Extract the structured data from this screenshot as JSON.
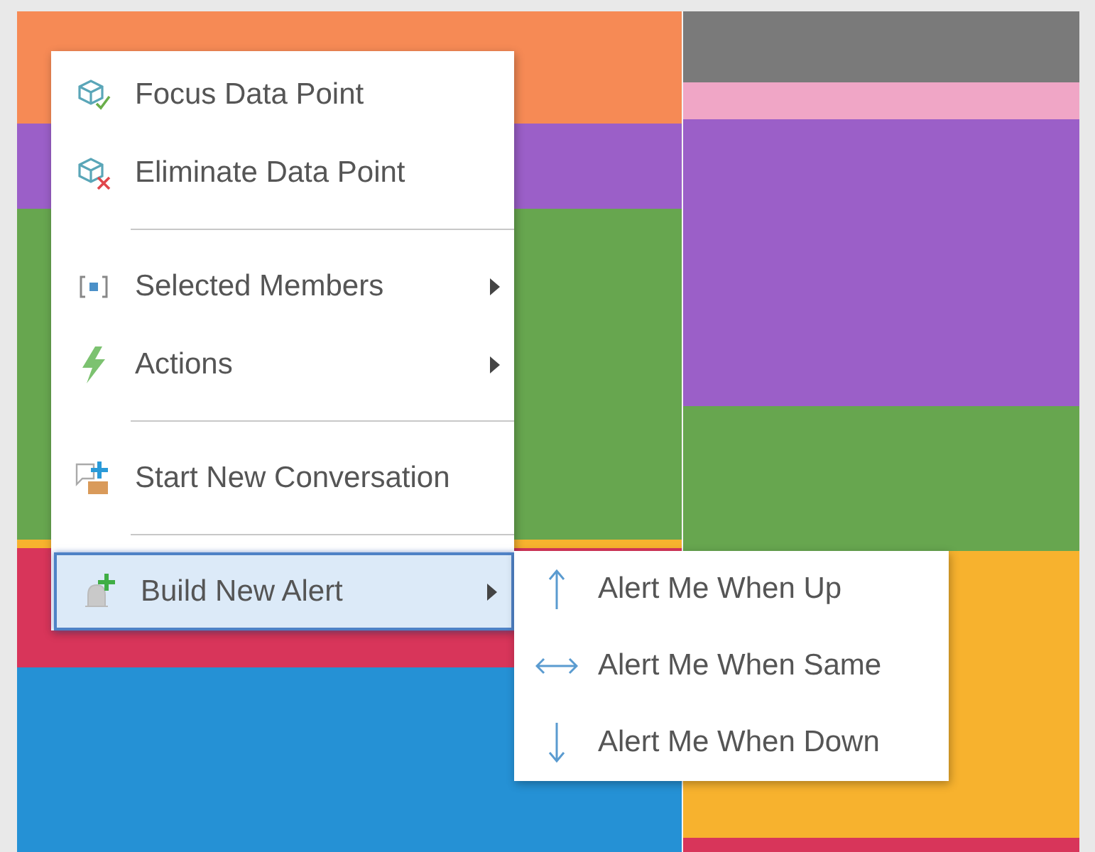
{
  "treemap": {
    "left": [
      {
        "color": "#f68a55"
      },
      {
        "color": "#9b5fc8"
      },
      {
        "color": "#67a64f"
      },
      {
        "color": "#f7b22e"
      },
      {
        "color": "#d8355a"
      },
      {
        "color": "#2591d5"
      }
    ],
    "right": [
      {
        "color": "#7a7a7a"
      },
      {
        "color": "#f0a6c6"
      },
      {
        "color": "#9b5fc8"
      },
      {
        "color": "#67a64f"
      },
      {
        "color": "#f7b22e"
      },
      {
        "color": "#d8355a"
      }
    ]
  },
  "context_menu": {
    "items": [
      {
        "kind": "item",
        "label": "Focus Data Point",
        "has_submenu": false,
        "selected": false
      },
      {
        "kind": "item",
        "label": "Eliminate Data Point",
        "has_submenu": false,
        "selected": false
      },
      {
        "kind": "separator"
      },
      {
        "kind": "item",
        "label": "Selected Members",
        "has_submenu": true,
        "selected": false
      },
      {
        "kind": "item",
        "label": "Actions",
        "has_submenu": true,
        "selected": false
      },
      {
        "kind": "separator"
      },
      {
        "kind": "item",
        "label": "Start New Conversation",
        "has_submenu": false,
        "selected": false
      },
      {
        "kind": "separator"
      },
      {
        "kind": "item",
        "label": "Build New Alert",
        "has_submenu": true,
        "selected": true
      }
    ]
  },
  "submenu": {
    "items": [
      {
        "kind": "up",
        "label": "Alert Me When Up"
      },
      {
        "kind": "same",
        "label": "Alert Me When Same"
      },
      {
        "kind": "down",
        "label": "Alert Me When Down"
      }
    ]
  }
}
